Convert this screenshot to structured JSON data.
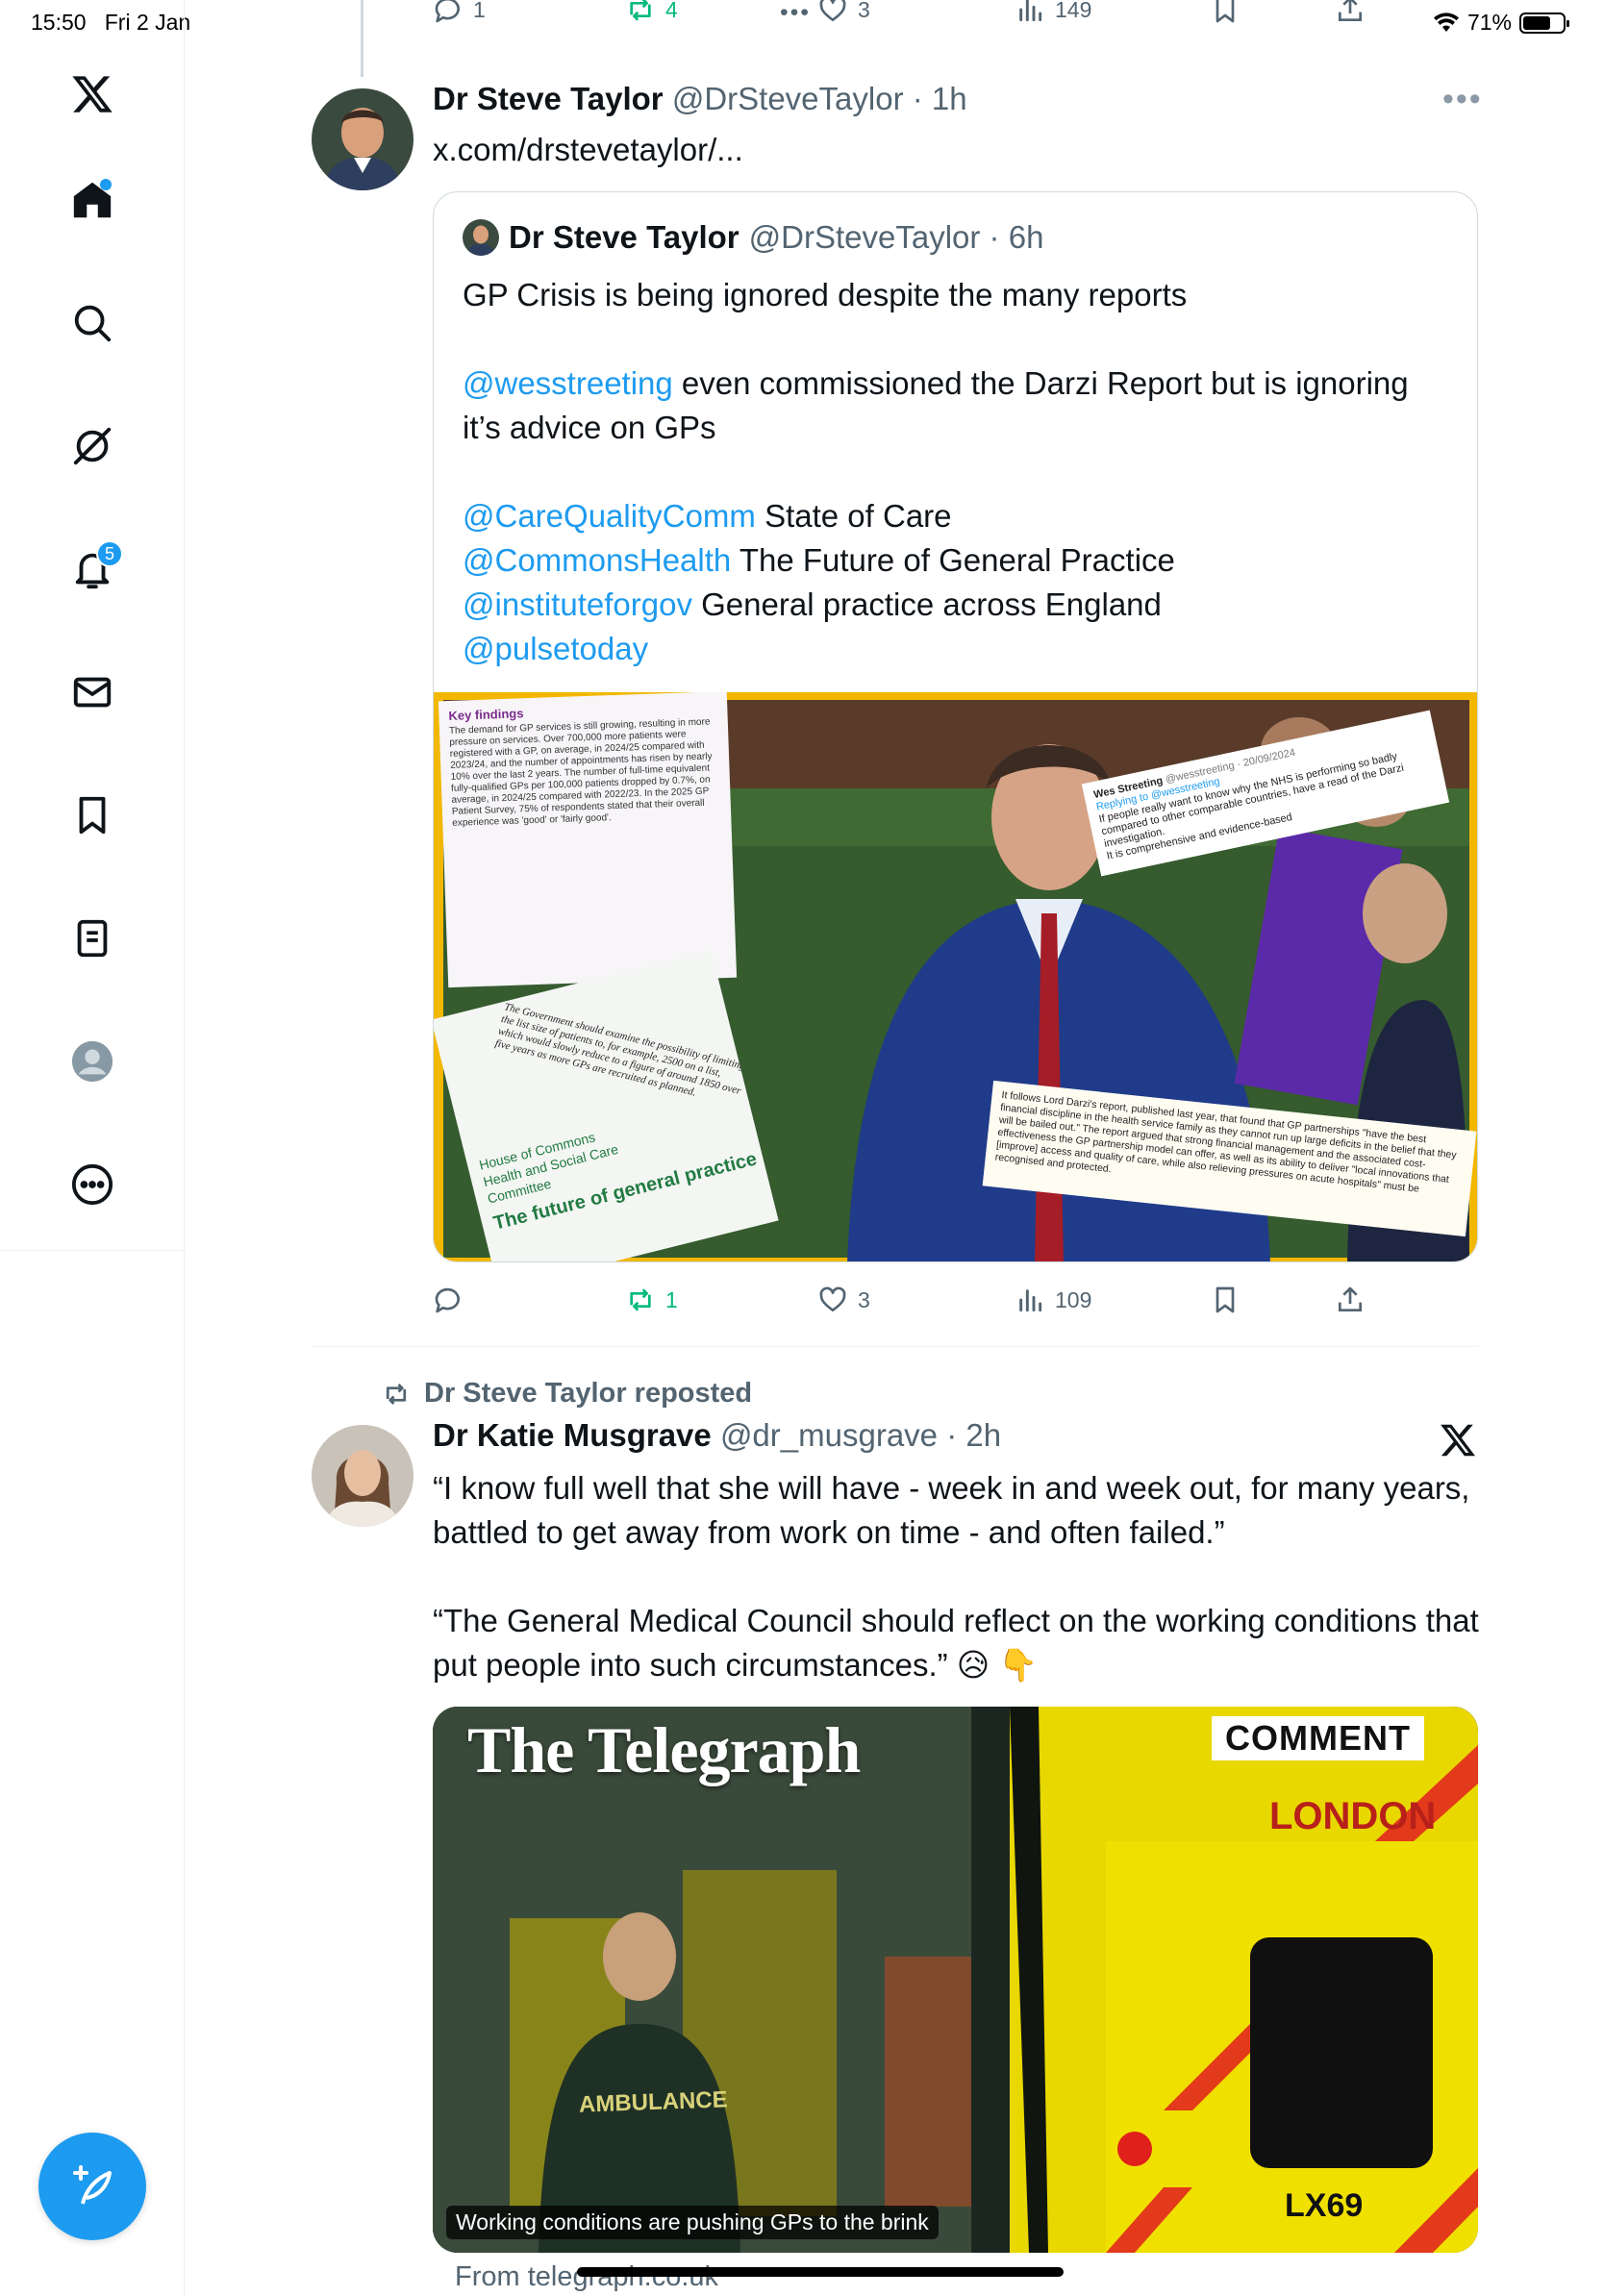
{
  "status_bar": {
    "time": "15:50",
    "date": "Fri 2 Jan",
    "battery": "71%",
    "battery_level": 0.71
  },
  "nav": {
    "notifications_badge": "5"
  },
  "prev_tweet_actions": {
    "replies": "1",
    "reposts": "4",
    "likes": "3",
    "views": "149"
  },
  "tweet1": {
    "name": "Dr Steve Taylor",
    "handle": "@DrSteveTaylor",
    "time": "1h",
    "link": "x.com/drstevetaylor/...",
    "quote": {
      "name": "Dr Steve Taylor",
      "handle": "@DrSteveTaylor",
      "time": "6h",
      "line1": "GP Crisis is being ignored despite the many reports",
      "mention1": "@wesstreeting",
      "line2": " even commissioned the Darzi Report but is ignoring it’s advice on GPs",
      "mention2": "@CareQualityComm",
      "text2": " State of Care",
      "mention3": "@CommonsHealth",
      "text3": " The Future of General Practice",
      "mention4": "@instituteforgov",
      "text4": " General practice across England",
      "mention5": "@pulsetoday",
      "media": {
        "key_findings_title": "Key findings",
        "key_findings_text": "The demand for GP services is still growing, resulting in more pressure on services. Over 700,000 more patients were registered with a GP, on average, in 2024/25 compared with 2023/24, and the number of appointments has risen by nearly 10% over the last 2 years. The number of full-time equivalent fully-qualified GPs per 100,000 patients dropped by 0.7%, on average, in 2024/25 compared with 2022/23. In the 2025 GP Patient Survey, 75% of respondents stated that their overall experience was 'good' or 'fairly good'.",
        "wes_name": "Wes Streeting",
        "wes_handle": "@wesstreeting · 20/09/2024",
        "wes_reply": "Replying to @wesstreeting",
        "wes_text": "If people really want to know why the NHS is performing so badly compared to other comparable countries, have a read of the Darzi investigation.",
        "wes_text2": "It is comprehensive and evidence-based",
        "commons_text": "The Government should examine the possibility of limiting the list size of patients to, for example, 2500 on a list, which would slowly reduce to a figure of around 1850 over five years as more GPs are recruited as planned.",
        "commons_org1": "House of Commons",
        "commons_org2": "Health and Social Care",
        "commons_org3": "Committee",
        "commons_title": "The future of general practice",
        "darzi_text": "It follows Lord Darzi's report, published last year, that found that GP partnerships \"have the best financial discipline in the health service family as they cannot run up large deficits in the belief that they will be bailed out.\" The report argued that strong financial management and the associated cost-effectiveness the GP partnership model can offer, as well as its ability to deliver \"local innovations that [improve] access and quality of care, while also relieving pressures on acute hospitals\" must be recognised and protected."
      }
    },
    "actions": {
      "replies": "",
      "reposts": "1",
      "likes": "3",
      "views": "109"
    }
  },
  "tweet2": {
    "repost_label": "Dr Steve Taylor reposted",
    "name": "Dr Katie Musgrave",
    "handle": "@dr_musgrave",
    "time": "2h",
    "text1": "“I know full well that she will have - week in and week out, for many years, battled to get away from work on time - and often failed.”",
    "text2": "“The General Medical Council should reflect on the working conditions that put people into such circumstances.” 😥 👇",
    "card": {
      "masthead": "The Telegraph",
      "badge": "COMMENT",
      "ambulance_back": "LONDON",
      "plate": "LX69",
      "vest": "AMBULANCE",
      "caption": "Working conditions are pushing GPs to the brink",
      "source": "From telegraph.co.uk"
    }
  }
}
